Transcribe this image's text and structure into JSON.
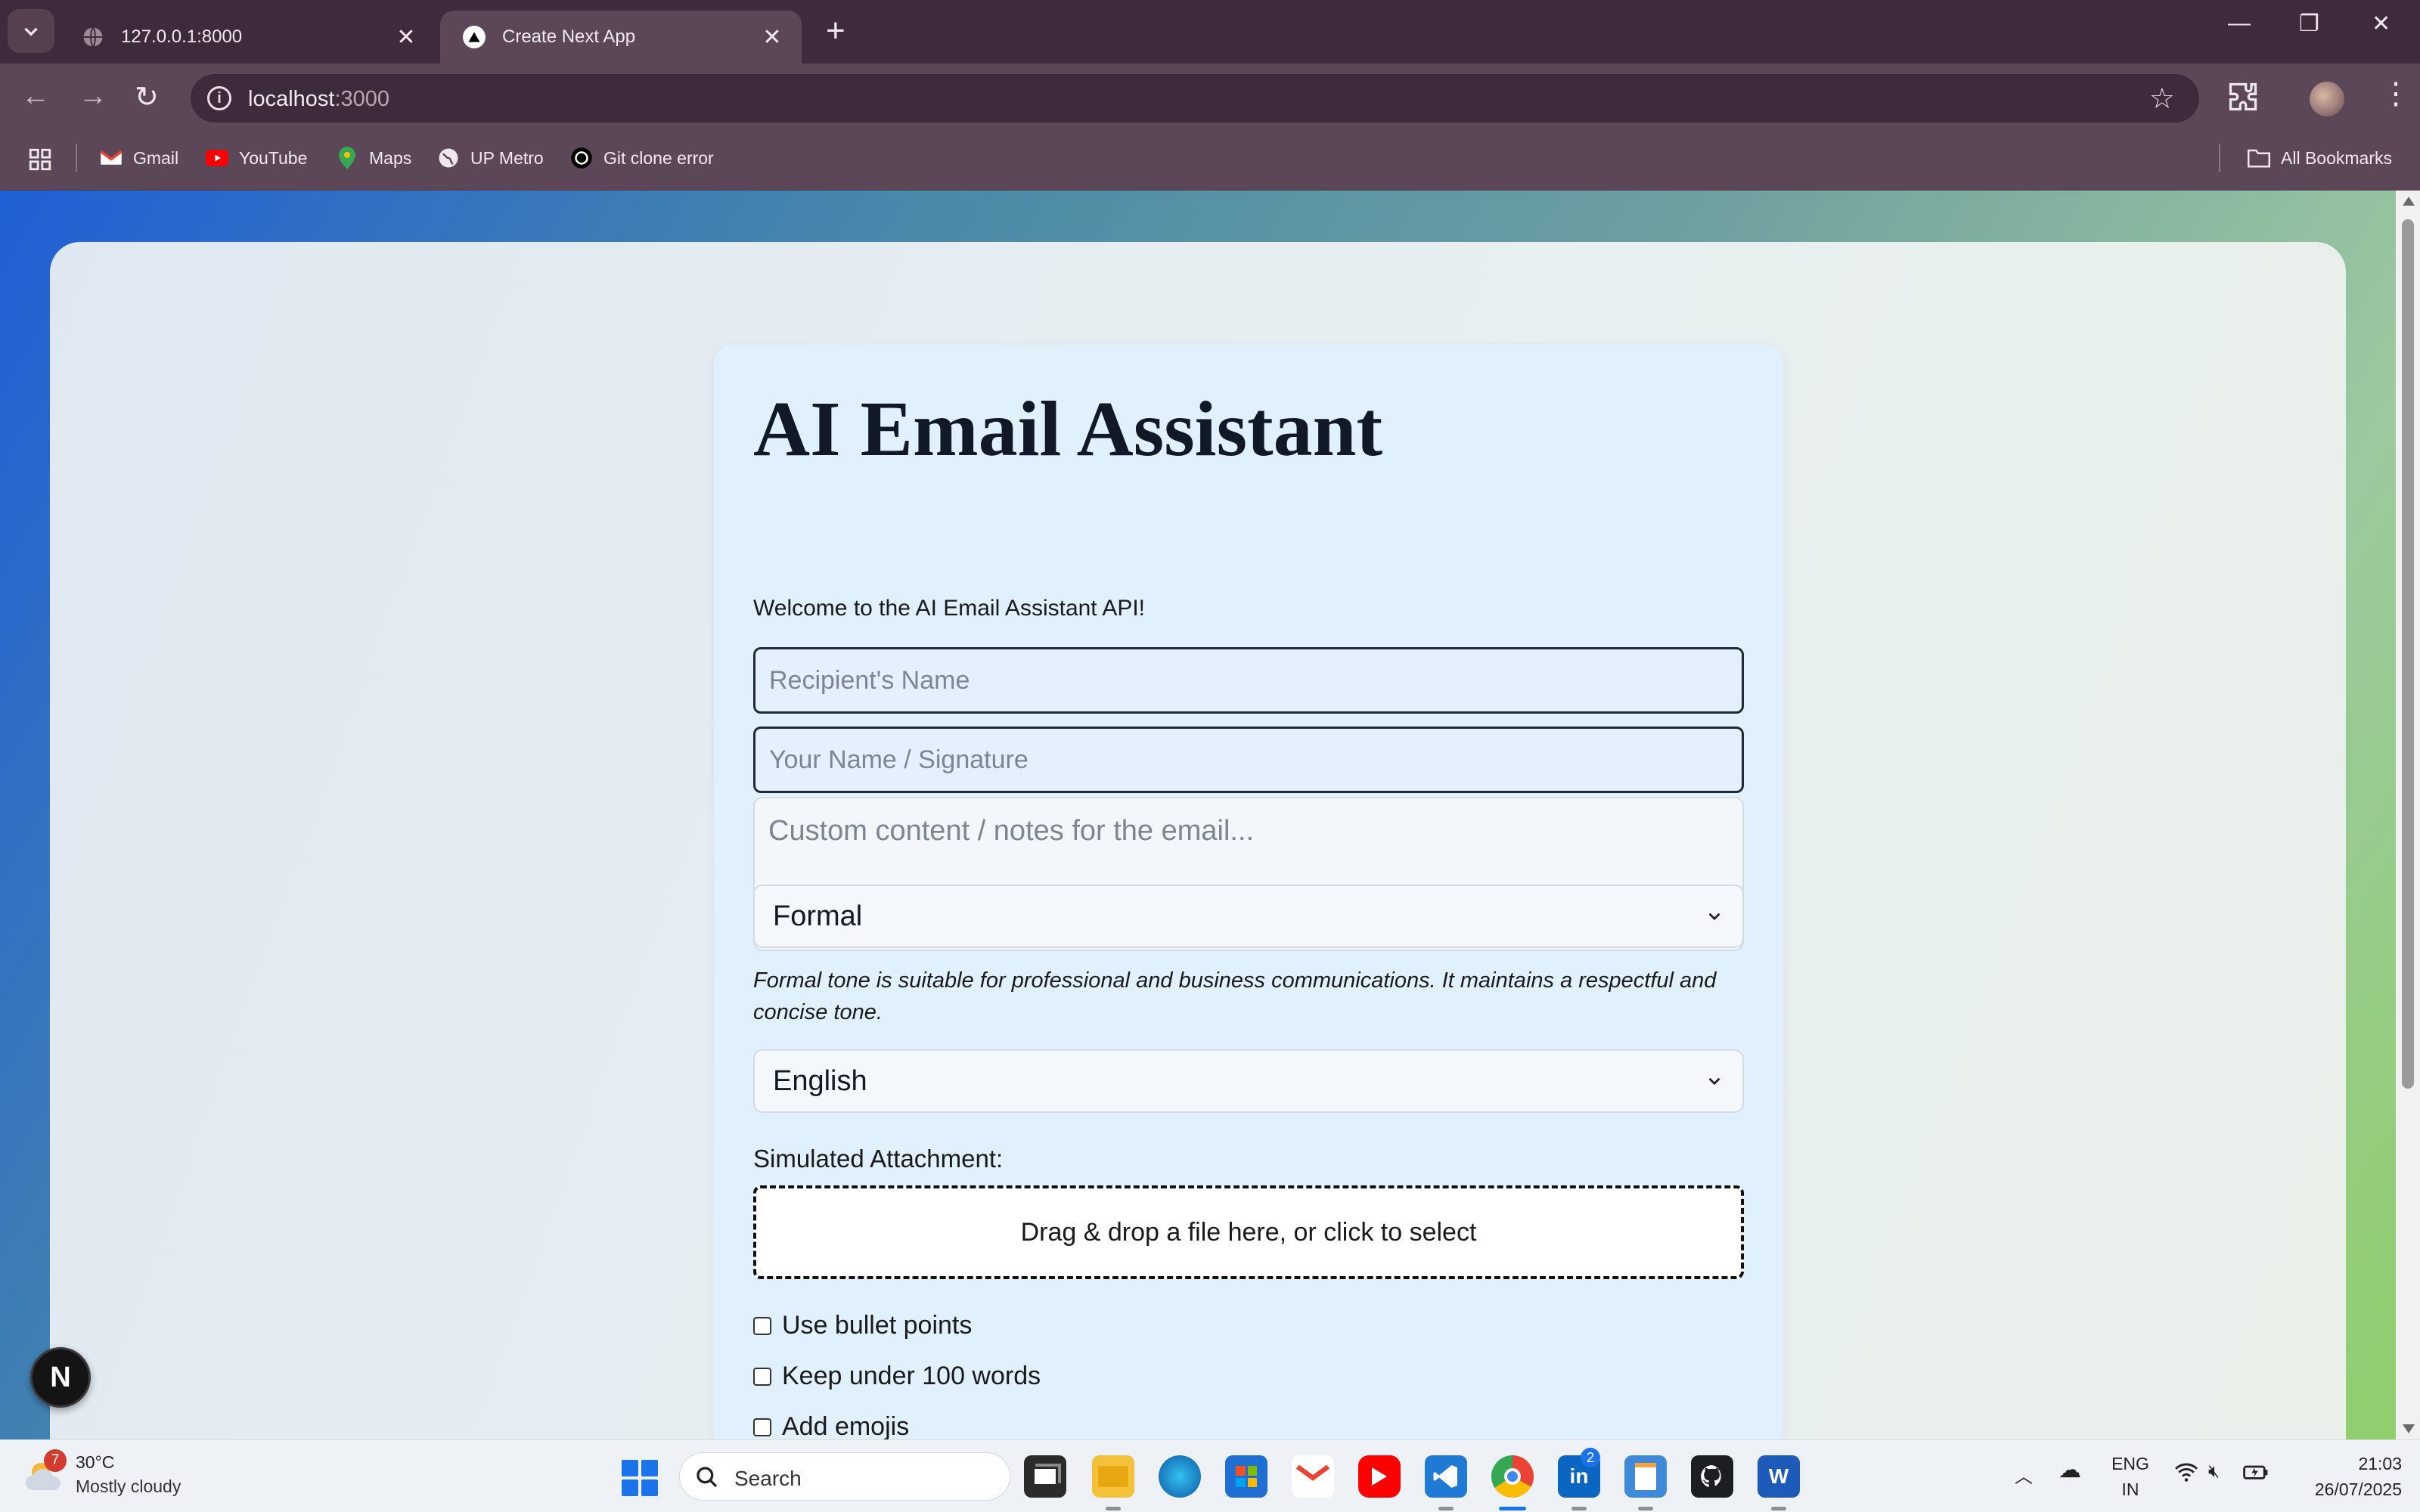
{
  "browser": {
    "tabs": [
      {
        "title": "127.0.0.1:8000"
      },
      {
        "title": "Create Next App",
        "active": true
      }
    ],
    "url_host": "localhost",
    "url_port": ":3000",
    "bookmarks": [
      "Gmail",
      "YouTube",
      "Maps",
      "UP Metro",
      "Git clone error"
    ],
    "all_bookmarks": "All Bookmarks"
  },
  "page": {
    "title": "AI Email Assistant",
    "welcome": "Welcome to the AI Email Assistant API!",
    "recipient_placeholder": "Recipient's Name",
    "signature_placeholder": "Your Name / Signature",
    "notes_placeholder": "Custom content / notes for the email...",
    "tone_selected": "Formal",
    "tone_note": "Formal tone is suitable for professional and business communications. It maintains a respectful and concise tone.",
    "language_selected": "English",
    "attachment_label": "Simulated Attachment:",
    "dropzone_text": "Drag & drop a file here, or click to select",
    "options": [
      {
        "label": "Use bullet points",
        "checked": false
      },
      {
        "label": "Keep under 100 words",
        "checked": false
      },
      {
        "label": "Add emojis",
        "checked": false
      }
    ],
    "dev_badge": "N"
  },
  "taskbar": {
    "weather_alerts": "7",
    "temperature": "30°C",
    "weather_desc": "Mostly cloudy",
    "search_placeholder": "Search",
    "linkedin_badge": "2",
    "lang_top": "ENG",
    "lang_bottom": "IN",
    "time": "21:03",
    "date": "26/07/2025"
  },
  "colors": {
    "accent_button": "#1d5fe0",
    "panel_bg": "#e0f0fd",
    "chrome_dark": "#3d2a3c",
    "chrome_mid": "#5c4758"
  }
}
